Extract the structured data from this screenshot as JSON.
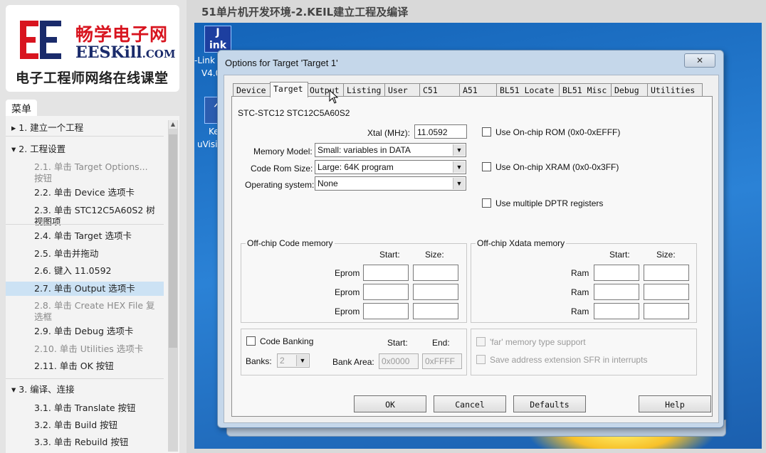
{
  "logo": {
    "cn": "畅学电子网",
    "en_main": "EESKill",
    "en_suffix": ".COM",
    "tagline": "电子工程师网络在线课堂"
  },
  "menu": {
    "tab_label": "菜单",
    "items": [
      {
        "label": "▸ 1. 建立一个工程",
        "kind": "section"
      },
      {
        "label": "▾ 2. 工程设置",
        "kind": "section"
      },
      {
        "label": "2.1. 单击 Target Options... 按钮",
        "kind": "sub-dim"
      },
      {
        "label": "2.2. 单击 Device 选项卡",
        "kind": "sub"
      },
      {
        "label": "2.3. 单击 STC12C5A60S2 树视图项",
        "kind": "sub"
      },
      {
        "label": "2.4. 单击 Target 选项卡",
        "kind": "sub"
      },
      {
        "label": "2.5. 单击并拖动",
        "kind": "sub"
      },
      {
        "label": "2.6. 键入 11.0592",
        "kind": "sub"
      },
      {
        "label": "2.7. 单击 Output 选项卡",
        "kind": "sub-active"
      },
      {
        "label": "2.8. 单击 Create HEX File 复选框",
        "kind": "sub-dim"
      },
      {
        "label": "2.9. 单击 Debug 选项卡",
        "kind": "sub"
      },
      {
        "label": "2.10. 单击 Utilities 选项卡",
        "kind": "sub-dim"
      },
      {
        "label": "2.11. 单击 OK 按钮",
        "kind": "sub"
      },
      {
        "label": "▾ 3. 编译、连接",
        "kind": "section"
      },
      {
        "label": "3.1. 单击 Translate 按钮",
        "kind": "sub"
      },
      {
        "label": "3.2. 单击 Build 按钮",
        "kind": "sub"
      },
      {
        "label": "3.3. 单击 Rebuild 按钮",
        "kind": "sub"
      }
    ]
  },
  "page_title": "51单片机开发环境-2.KEIL建立工程及编译",
  "desktop": {
    "icon1_glyph": "J\nink",
    "icon1_label_a": "-Link",
    "icon1_label_b": "V4.0",
    "icon2_label_a": "Ke",
    "icon2_label_b": "uVisi"
  },
  "dialog": {
    "title": "Options for Target 'Target 1'",
    "close": "✕",
    "tabs": [
      "Device",
      "Target",
      "Output",
      "Listing",
      "User",
      "C51",
      "A51",
      "BL51 Locate",
      "BL51 Misc",
      "Debug",
      "Utilities"
    ],
    "selected_tab": "Target",
    "device_name": "STC-STC12 STC12C5A60S2",
    "xtal_label": "Xtal (MHz):",
    "xtal_value": "11.0592",
    "memory_model_label": "Memory Model:",
    "memory_model_value": "Small: variables in DATA",
    "code_rom_label": "Code Rom Size:",
    "code_rom_value": "Large: 64K program",
    "os_label": "Operating system:",
    "os_value": "None",
    "onchip_rom": "Use On-chip ROM (0x0-0xEFFF)",
    "onchip_xram": "Use On-chip XRAM (0x0-0x3FF)",
    "multi_dptr": "Use multiple DPTR registers",
    "code_mem_title": "Off-chip Code memory",
    "xdata_mem_title": "Off-chip Xdata memory",
    "start": "Start:",
    "size": "Size:",
    "eprom": "Eprom",
    "ram": "Ram",
    "code_banking": "Code Banking",
    "banks_label": "Banks:",
    "banks_value": "2",
    "bank_area_label": "Bank Area:",
    "bank_start_label": "Start:",
    "bank_end_label": "End:",
    "bank_start": "0x0000",
    "bank_end": "0xFFFF",
    "far_memory": "'far' memory type support",
    "save_addr": "Save address extension SFR in interrupts",
    "ok": "OK",
    "cancel": "Cancel",
    "defaults": "Defaults",
    "help": "Help"
  }
}
